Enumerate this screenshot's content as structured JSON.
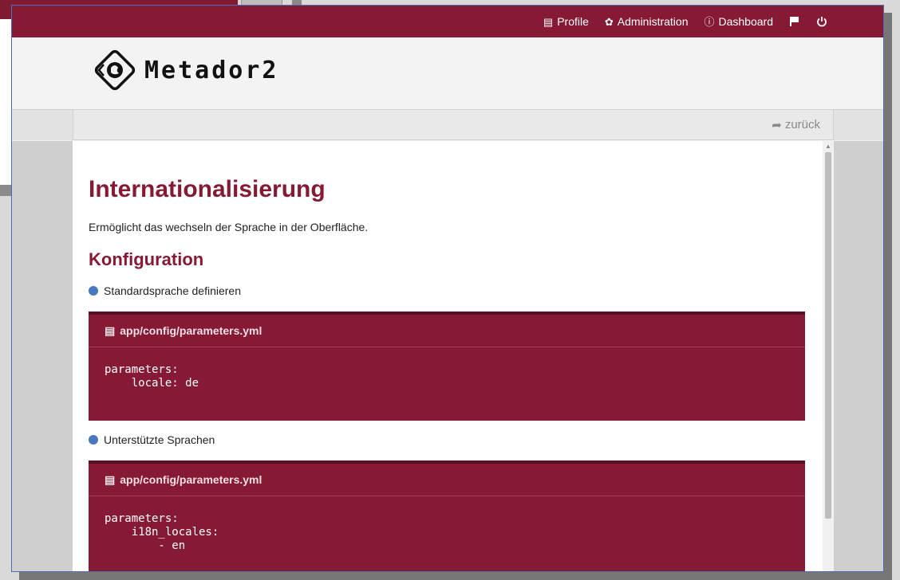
{
  "nav": {
    "profile": "Profile",
    "administration": "Administration",
    "dashboard": "Dashboard"
  },
  "header": {
    "logo_text": "Metador2"
  },
  "subbar": {
    "back_label": "zurück"
  },
  "page": {
    "title": "Internationalisierung",
    "description": "Ermöglicht das wechseln der Sprache in der Oberfläche.",
    "section_title": "Konfiguration",
    "bullet1": "Standardsprache definieren",
    "code1": {
      "file": "app/config/parameters.yml",
      "content": "parameters:\n    locale: de"
    },
    "bullet2": "Unterstützte Sprachen",
    "code2": {
      "file": "app/config/parameters.yml",
      "content": "parameters:\n    i18n_locales:\n        - en"
    }
  },
  "colors": {
    "brand": "#861a34",
    "bullet": "#4a78bf"
  },
  "icons": [
    "list-icon",
    "gear-icon",
    "info-icon",
    "flag-icon",
    "power-icon",
    "share-icon",
    "file-icon"
  ]
}
